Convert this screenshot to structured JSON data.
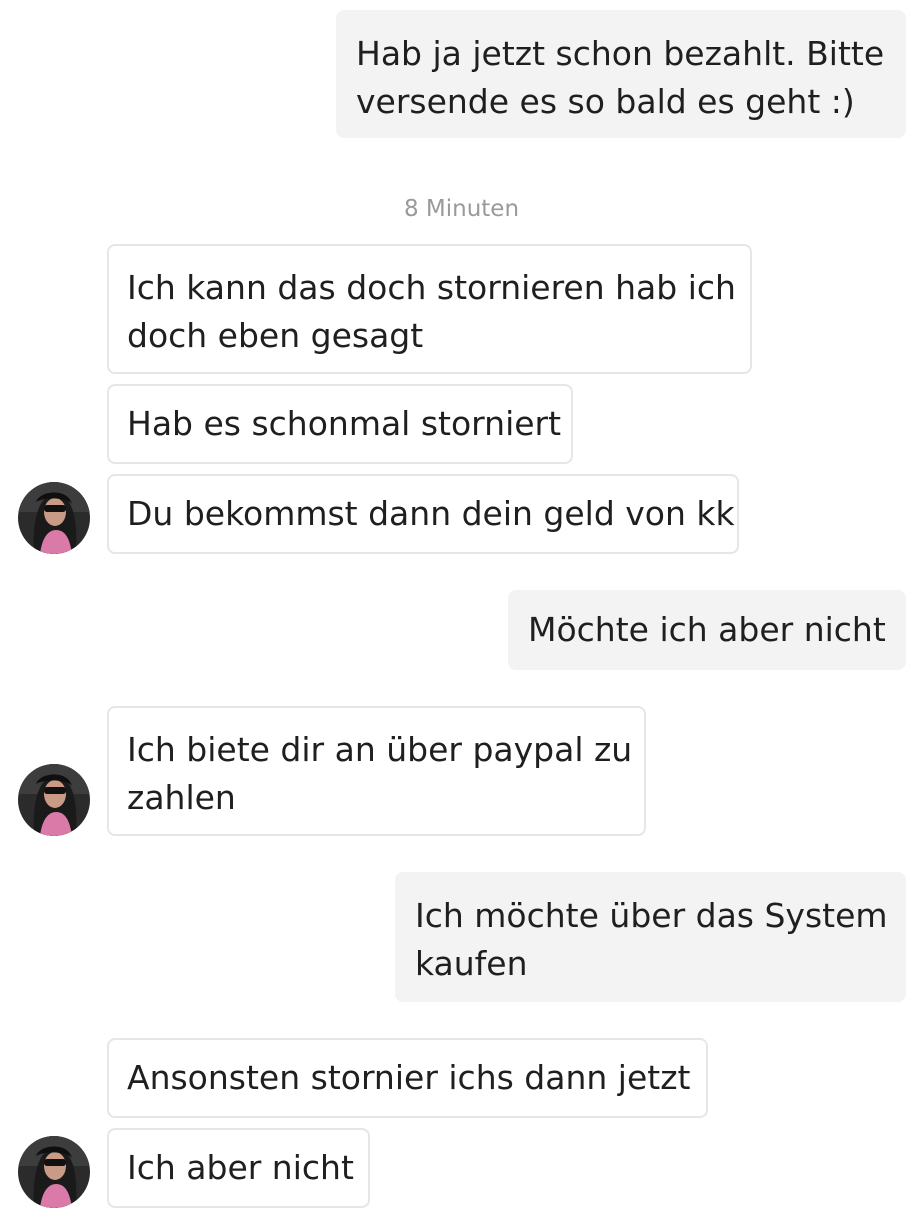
{
  "messages": [
    {
      "direction": "outgoing",
      "text": "Hab ja jetzt schon bezahlt. Bitte\nversende es so bald es geht :)"
    },
    {
      "direction": "incoming",
      "text": "Ich kann das doch stornieren hab ich\ndoch eben gesagt"
    },
    {
      "direction": "incoming",
      "text": "Hab es schonmal storniert"
    },
    {
      "direction": "incoming",
      "text": "Du bekommst dann dein geld von kk"
    },
    {
      "direction": "outgoing",
      "text": "Möchte ich aber nicht"
    },
    {
      "direction": "incoming",
      "text": "Ich biete dir an über paypal zu\nzahlen"
    },
    {
      "direction": "outgoing",
      "text": "Ich möchte über das System\nkaufen"
    },
    {
      "direction": "incoming",
      "text": "Ansonsten stornier ichs dann jetzt"
    },
    {
      "direction": "incoming",
      "text": "Ich aber nicht"
    }
  ],
  "timestamp": "8 Minuten",
  "colors": {
    "outgoing_bg": "#f3f3f3",
    "incoming_border": "#e6e6e6",
    "timestamp_text": "#9a9a9a"
  },
  "icons": {
    "avatar": "user-avatar-photo"
  }
}
